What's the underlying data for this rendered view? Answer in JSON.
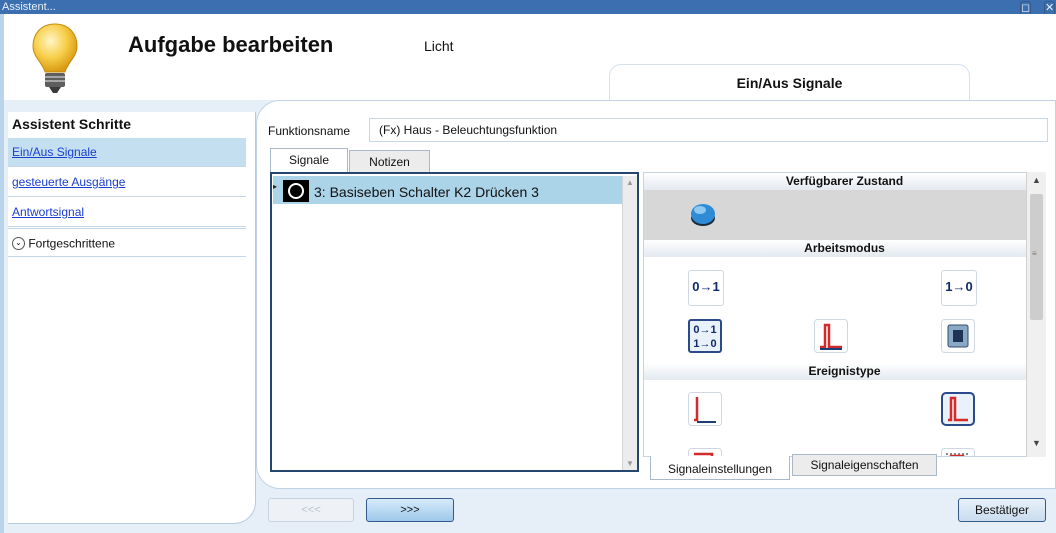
{
  "window": {
    "title": "Assistent..."
  },
  "header": {
    "title": "Aufgabe bearbeiten",
    "subtitle": "Licht",
    "step_tab": "Ein/Aus Signale"
  },
  "sidebar": {
    "title": "Assistent Schritte",
    "items": [
      {
        "label": "Ein/Aus Signale"
      },
      {
        "label": "gesteuerte Ausgänge"
      },
      {
        "label": "Antwortsignal"
      },
      {
        "label": "Fortgeschrittene"
      }
    ]
  },
  "form": {
    "function_label": "Funktionsname",
    "function_value": "(Fx) Haus - Beleuchtungsfunktion"
  },
  "tabs": [
    {
      "label": "Signale"
    },
    {
      "label": "Notizen"
    }
  ],
  "signals": [
    {
      "label": "3: Basiseben Schalter K2 Drücken 3"
    }
  ],
  "panel": {
    "section_state": "Verfügbarer Zustand",
    "section_mode": "Arbeitsmodus",
    "section_event": "Ereignistype",
    "mode_up": "0→1",
    "mode_down": "1→0",
    "mode_toggle_top": "0→1",
    "mode_toggle_bottom": "1→0"
  },
  "bottom_tabs": [
    {
      "label": "Signaleinstellungen"
    },
    {
      "label": "Signaleigenschaften"
    }
  ],
  "buttons": {
    "back": "<<<",
    "next": ">>>",
    "confirm": "Bestätiger"
  },
  "colors": {
    "titlebar": "#3b6fb0",
    "selection": "#acd4e8",
    "link": "#1a3fcf"
  }
}
